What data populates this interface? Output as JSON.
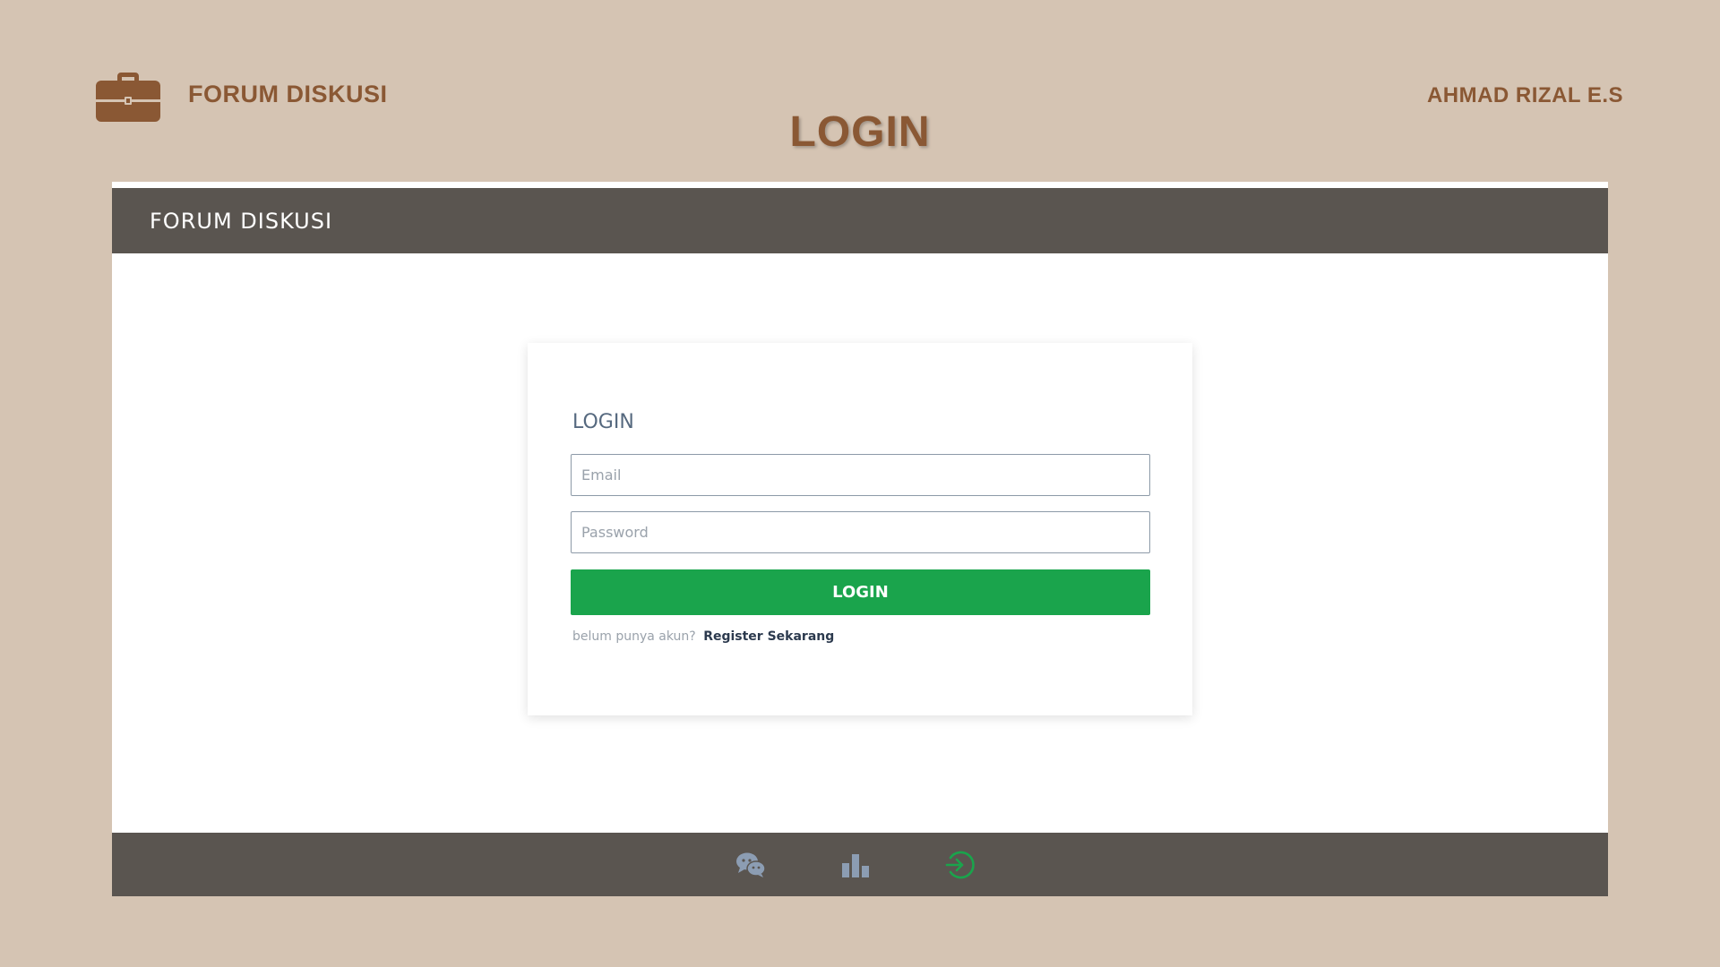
{
  "slide": {
    "brand": "FORUM DISKUSI",
    "title": "LOGIN",
    "author": "AHMAD RIZAL E.S",
    "logo_icon": "briefcase-icon"
  },
  "app": {
    "navbar": {
      "brand": "FORUM DISKUSI"
    },
    "login_form": {
      "heading": "LOGIN",
      "email_placeholder": "Email",
      "password_placeholder": "Password",
      "submit_label": "LOGIN",
      "register_prompt": "belum punya akun?",
      "register_link": "Register Sekarang"
    },
    "footer": {
      "icons": [
        "chat-icon",
        "bar-chart-icon",
        "login-icon"
      ],
      "active_icon_color": "#1aa44c",
      "inactive_icon_color": "#8c9db3"
    }
  },
  "colors": {
    "background": "#d5c4b3",
    "accent_brown": "#8a5834",
    "navbar": "#5a5550",
    "button_green": "#1aa44c"
  }
}
